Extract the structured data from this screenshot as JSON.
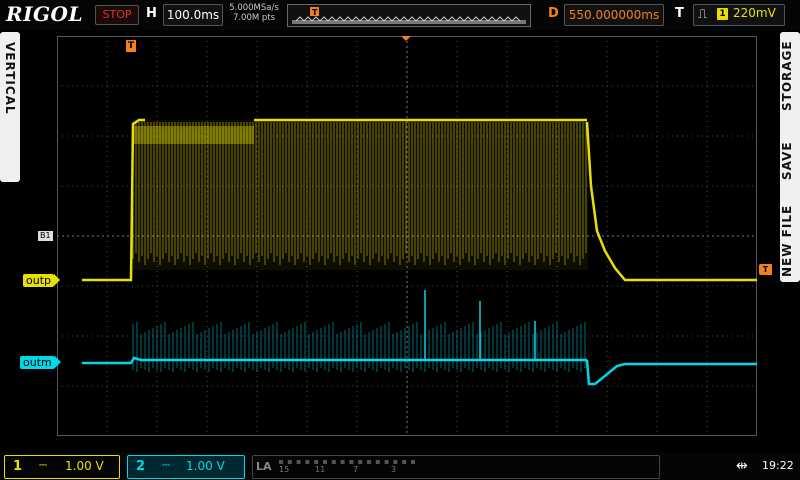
{
  "header": {
    "brand": "RIGOL",
    "run_status": "STOP",
    "h_label": "H",
    "timebase": "100.0ms",
    "sample_rate": "5.000MSa/s",
    "memory_depth": "7.00M pts",
    "d_label": "D",
    "delay": "550.000000ms",
    "t_label": "T",
    "trigger_source": "1",
    "trigger_level": "220mV",
    "trigger_edge_icon": "rising-edge-icon"
  },
  "left_tab": {
    "label": "VERTICAL"
  },
  "right_menu": {
    "items": [
      "STORAGE",
      "SAVE",
      "NEW FILE"
    ]
  },
  "screen": {
    "ch1_name": "outp",
    "ch2_name": "outm",
    "bus_marker": "B1",
    "trigger_marker": "T",
    "colors": {
      "ch1": "#e8e000",
      "ch2": "#00d8e8",
      "trigger": "#f08020",
      "grid": "#4a4a4a"
    }
  },
  "channels": [
    {
      "number": "1",
      "coupling_icon": "dc-coupling-icon",
      "scale": "1.00 V"
    },
    {
      "number": "2",
      "coupling_icon": "dc-coupling-icon",
      "scale": "1.00 V"
    }
  ],
  "la": {
    "label": "LA",
    "channel_numbers": [
      "15",
      "11",
      "7",
      "3"
    ]
  },
  "status": {
    "usb_icon": "usb-icon",
    "time": "19:22"
  }
}
